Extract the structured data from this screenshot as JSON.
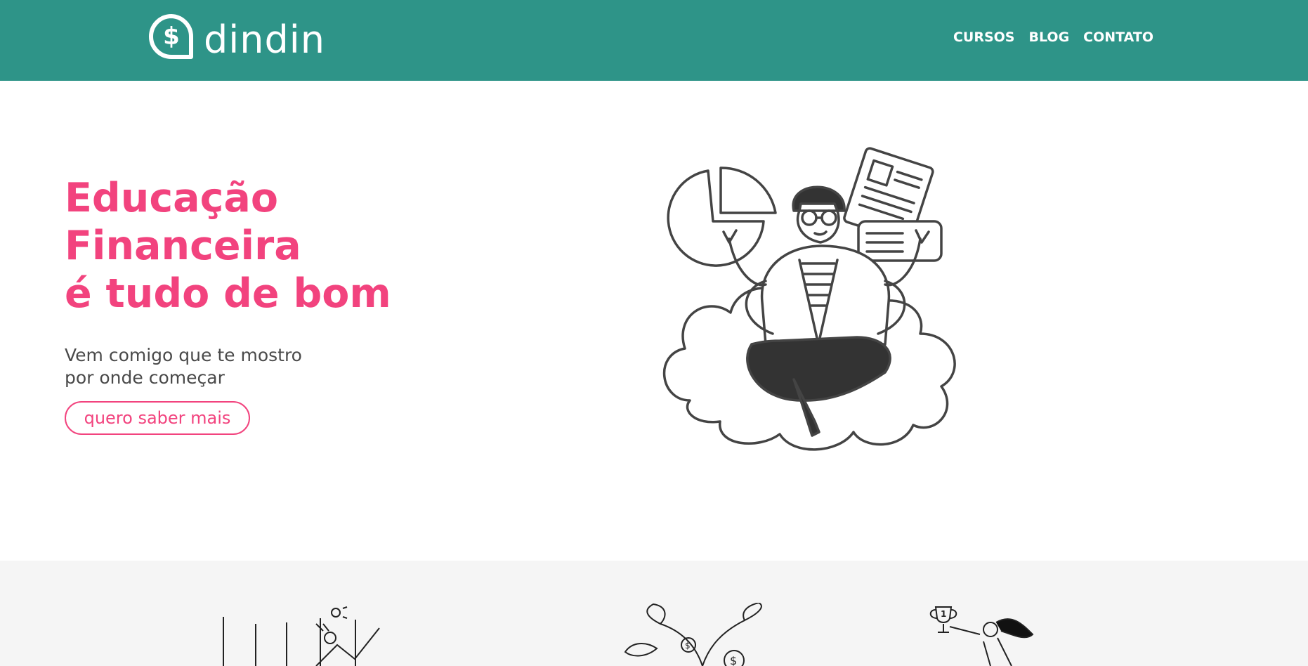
{
  "header": {
    "brand": "dindin",
    "logo_symbol": "$",
    "nav": [
      "CURSOS",
      "BLOG",
      "CONTATO"
    ]
  },
  "hero": {
    "title_lines": [
      "Educação",
      "Financeira",
      "é tudo de bom"
    ],
    "subtitle_lines": [
      "Vem comigo que te mostro",
      "por onde começar"
    ],
    "cta_label": "quero saber mais",
    "illustration": "person-meditating-on-cloud-icon"
  },
  "features": {
    "illustrations": [
      "growth-chart-person-icon",
      "money-plant-icon",
      "trophy-winner-icon"
    ],
    "trophy_number": "1"
  },
  "colors": {
    "header_bg": "#2e9488",
    "accent_pink": "#f2437e",
    "features_bg": "#f5f5f5",
    "text_gray": "#4a4a4a"
  }
}
